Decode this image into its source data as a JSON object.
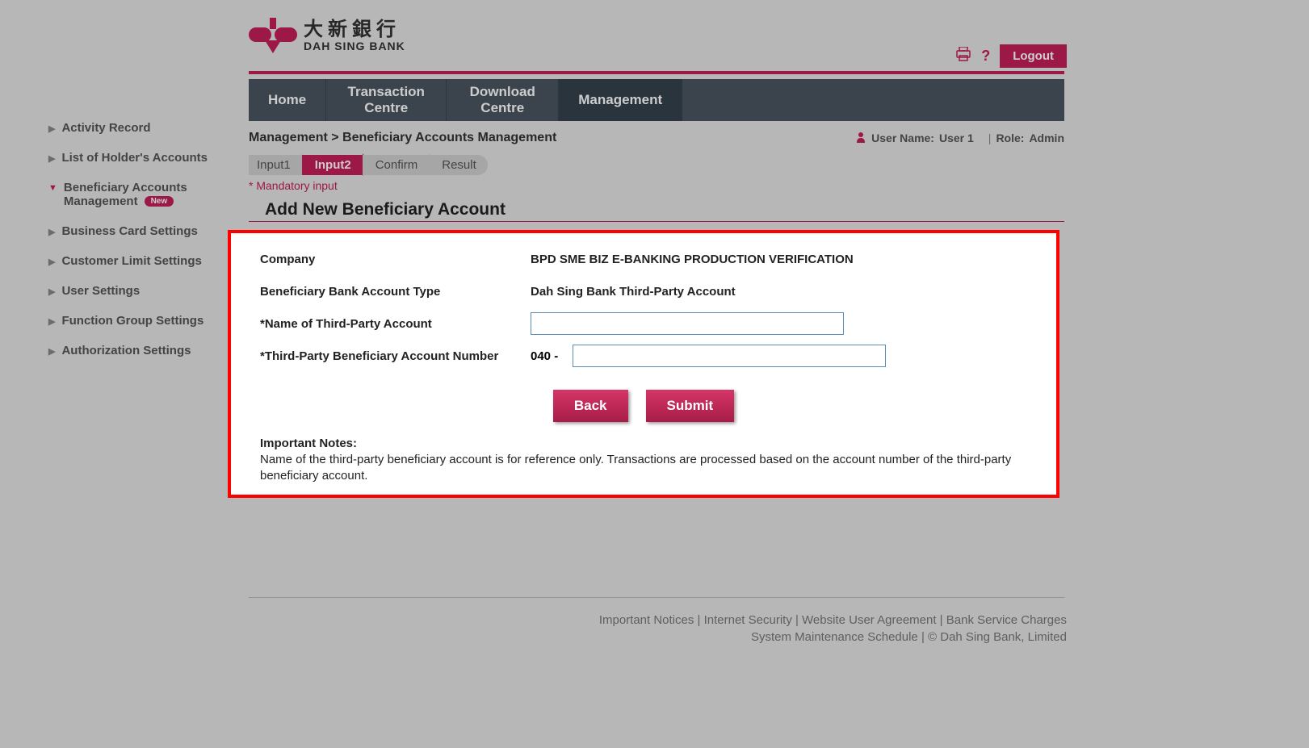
{
  "logo": {
    "chinese": "大新銀行",
    "english": "DAH SING BANK"
  },
  "topright": {
    "logout": "Logout"
  },
  "nav": {
    "home": "Home",
    "transaction": "Transaction Centre",
    "download": "Download Centre",
    "management": "Management"
  },
  "sidebar": {
    "items": [
      {
        "label": "Activity Record"
      },
      {
        "label": "List of Holder's Accounts"
      },
      {
        "label_line1": "Beneficiary Accounts",
        "label_line2": "Management",
        "badge": "New"
      },
      {
        "label": "Business Card Settings"
      },
      {
        "label": "Customer Limit Settings"
      },
      {
        "label": "User Settings"
      },
      {
        "label": "Function Group Settings"
      },
      {
        "label": "Authorization Settings"
      }
    ]
  },
  "breadcrumb": "Management > Beneficiary Accounts Management",
  "user": {
    "name_label": "User Name:",
    "name_value": "User 1",
    "role_label": "Role:",
    "role_value": "Admin"
  },
  "steps": {
    "s1": "Input1",
    "s2": "Input2",
    "s3": "Confirm",
    "s4": "Result"
  },
  "mandatory": "* Mandatory input",
  "page_title": "Add New Beneficiary Account",
  "form": {
    "company_label": "Company",
    "company_value": "BPD SME BIZ E-BANKING PRODUCTION VERIFICATION",
    "acct_type_label": "Beneficiary Bank Account Type",
    "acct_type_value": "Dah Sing Bank Third-Party Account",
    "name_label": "*Name of Third-Party Account",
    "acct_num_label": "*Third-Party Beneficiary Account Number",
    "acct_prefix": "040 -",
    "back_btn": "Back",
    "submit_btn": "Submit"
  },
  "notes": {
    "title": "Important Notes:",
    "body": "Name of the third-party beneficiary account is for reference only. Transactions are processed based on the account number of the third-party beneficiary account."
  },
  "footer": {
    "line1_a": "Important Notices",
    "line1_b": "Internet Security",
    "line1_c": "Website User Agreement",
    "line1_d": "Bank Service Charges",
    "line2_a": "System Maintenance Schedule",
    "line2_b": "© Dah Sing Bank, Limited"
  }
}
